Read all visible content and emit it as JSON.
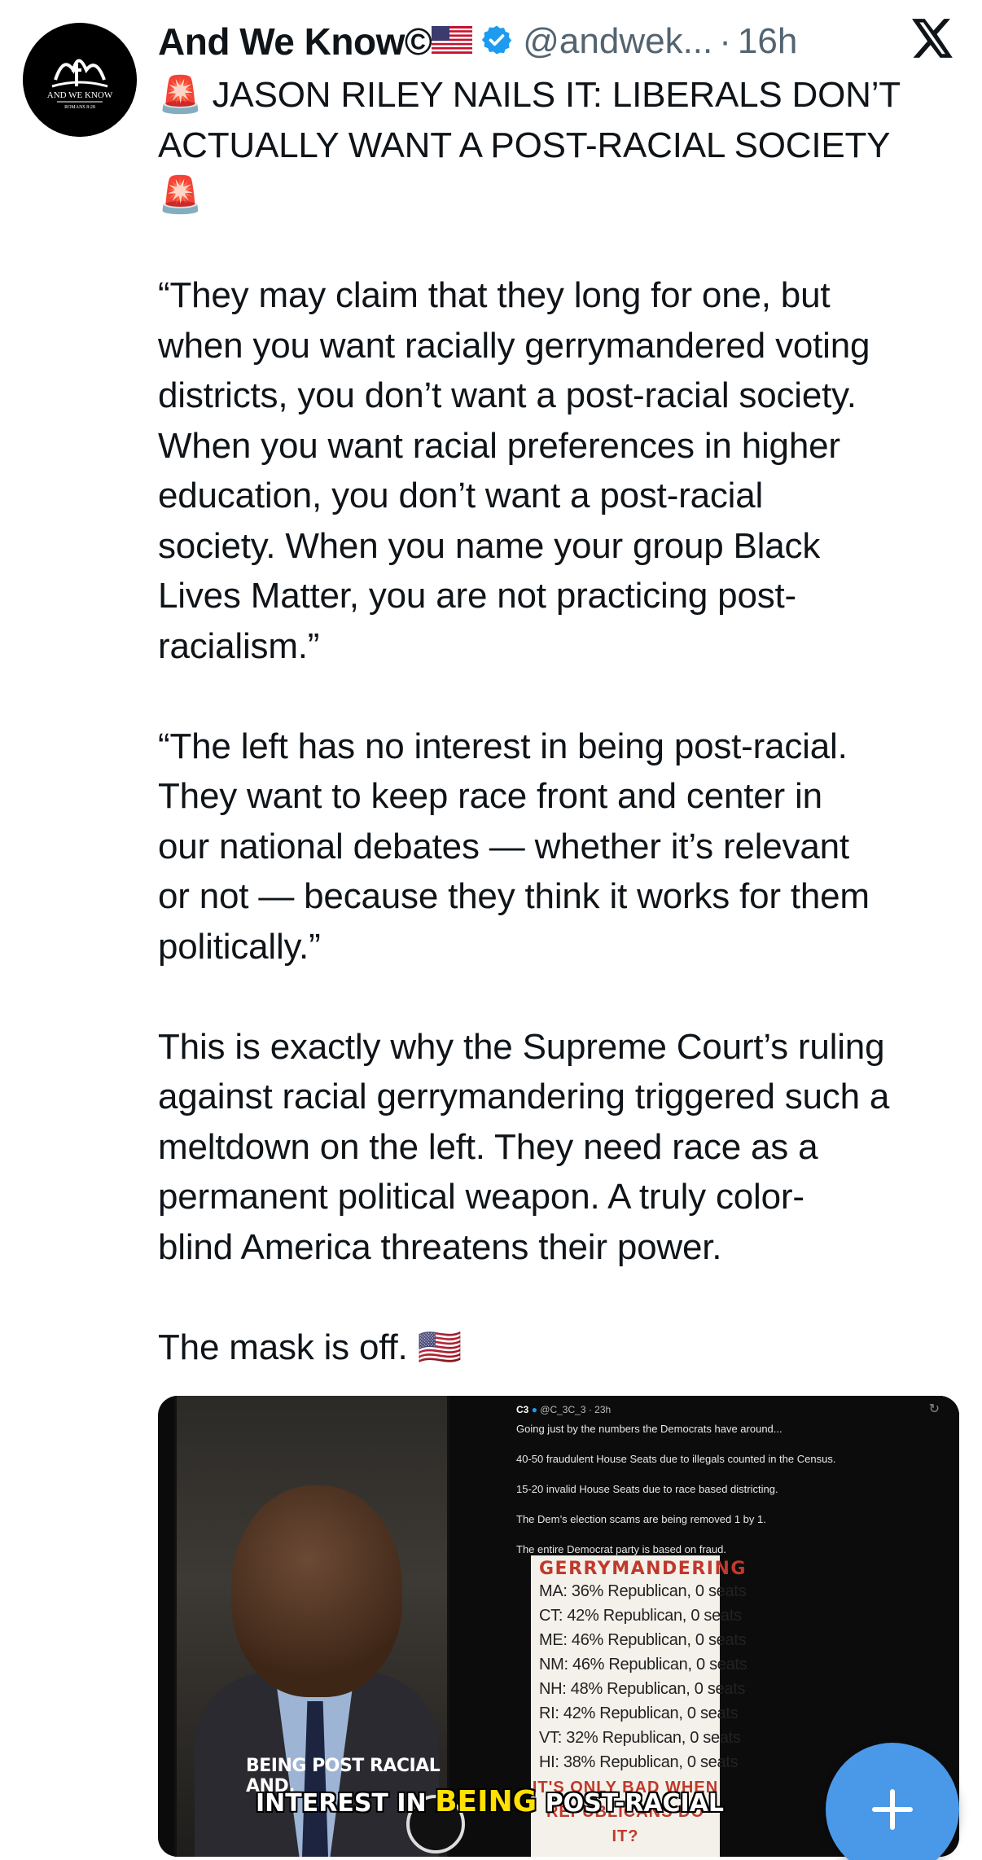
{
  "post": {
    "author_name": "And We Know©",
    "author_flag": "🇺🇸",
    "handle": "@andwek...",
    "separator": "·",
    "time": "16h",
    "avatar_logo_text": "AND WE KNOW",
    "avatar_logo_sub": "ROMANS 8:28"
  },
  "body": {
    "headline_siren_1": "🚨",
    "headline_line1": " JASON RILEY NAILS IT: LIBERALS DON’T",
    "headline_line2": "ACTUALLY WANT A POST-RACIAL SOCIETY",
    "headline_siren_2": "🚨",
    "quote1": "“They may claim that they long for one, but\nwhen you want racially gerrymandered voting\ndistricts, you don’t want a post-racial society.\nWhen you want racial preferences in higher\neducation, you don’t want a post-racial\nsociety. When you name your group Black\nLives Matter, you are not practicing post-\nracialism.”",
    "quote2": "“The left has no interest in being post-racial.\nThey want to keep race front and center in\nour national debates — whether it’s relevant\nor not — because they think it works for them\npolitically.”",
    "para3": "This is exactly why the Supreme Court’s ruling\nagainst racial gerrymandering triggered such a\nmeltdown on the left. They need race as a\npermanent political weapon. A truly color-\nblind America threatens their power.",
    "closing": "The mask is off. 🇺🇸"
  },
  "media": {
    "caption_left": "BEING POST RACIAL AND.",
    "caption_bottom_pre": "INTEREST IN ",
    "caption_bottom_hl": "BEING",
    "caption_bottom_post": " POST-RACIAL",
    "embedded_tweet": {
      "author": "C3",
      "handle_time": "@C_3C_3 · 23h",
      "lines": [
        "Going just by the numbers the Democrats have around...",
        "40-50 fraudulent House Seats due to illegals counted in the Census.",
        "15-20 invalid House Seats due to race based districting.",
        "The Dem’s election scams are being removed 1 by 1.",
        "The entire Democrat party is based on fraud."
      ]
    },
    "gerrymandering": {
      "title": "GERRYMANDERING",
      "rows": [
        "MA: 36% Republican, 0 seats",
        "CT: 42% Republican, 0 seats",
        "ME: 46% Republican, 0 seats",
        "NM: 46% Republican, 0 seats",
        "NH: 48% Republican, 0 seats",
        "RI: 42% Republican, 0 seats",
        "VT: 32% Republican, 0 seats",
        "HI: 38% Republican, 0 seats"
      ],
      "footer_line1": "IT'S ONLY BAD WHEN",
      "footer_line2": "REPUBLICANS DO IT?"
    }
  },
  "fab": {
    "label": "+"
  },
  "colors": {
    "accent": "#4a99e9",
    "verified": "#1d9bf0",
    "muted": "#536471"
  }
}
